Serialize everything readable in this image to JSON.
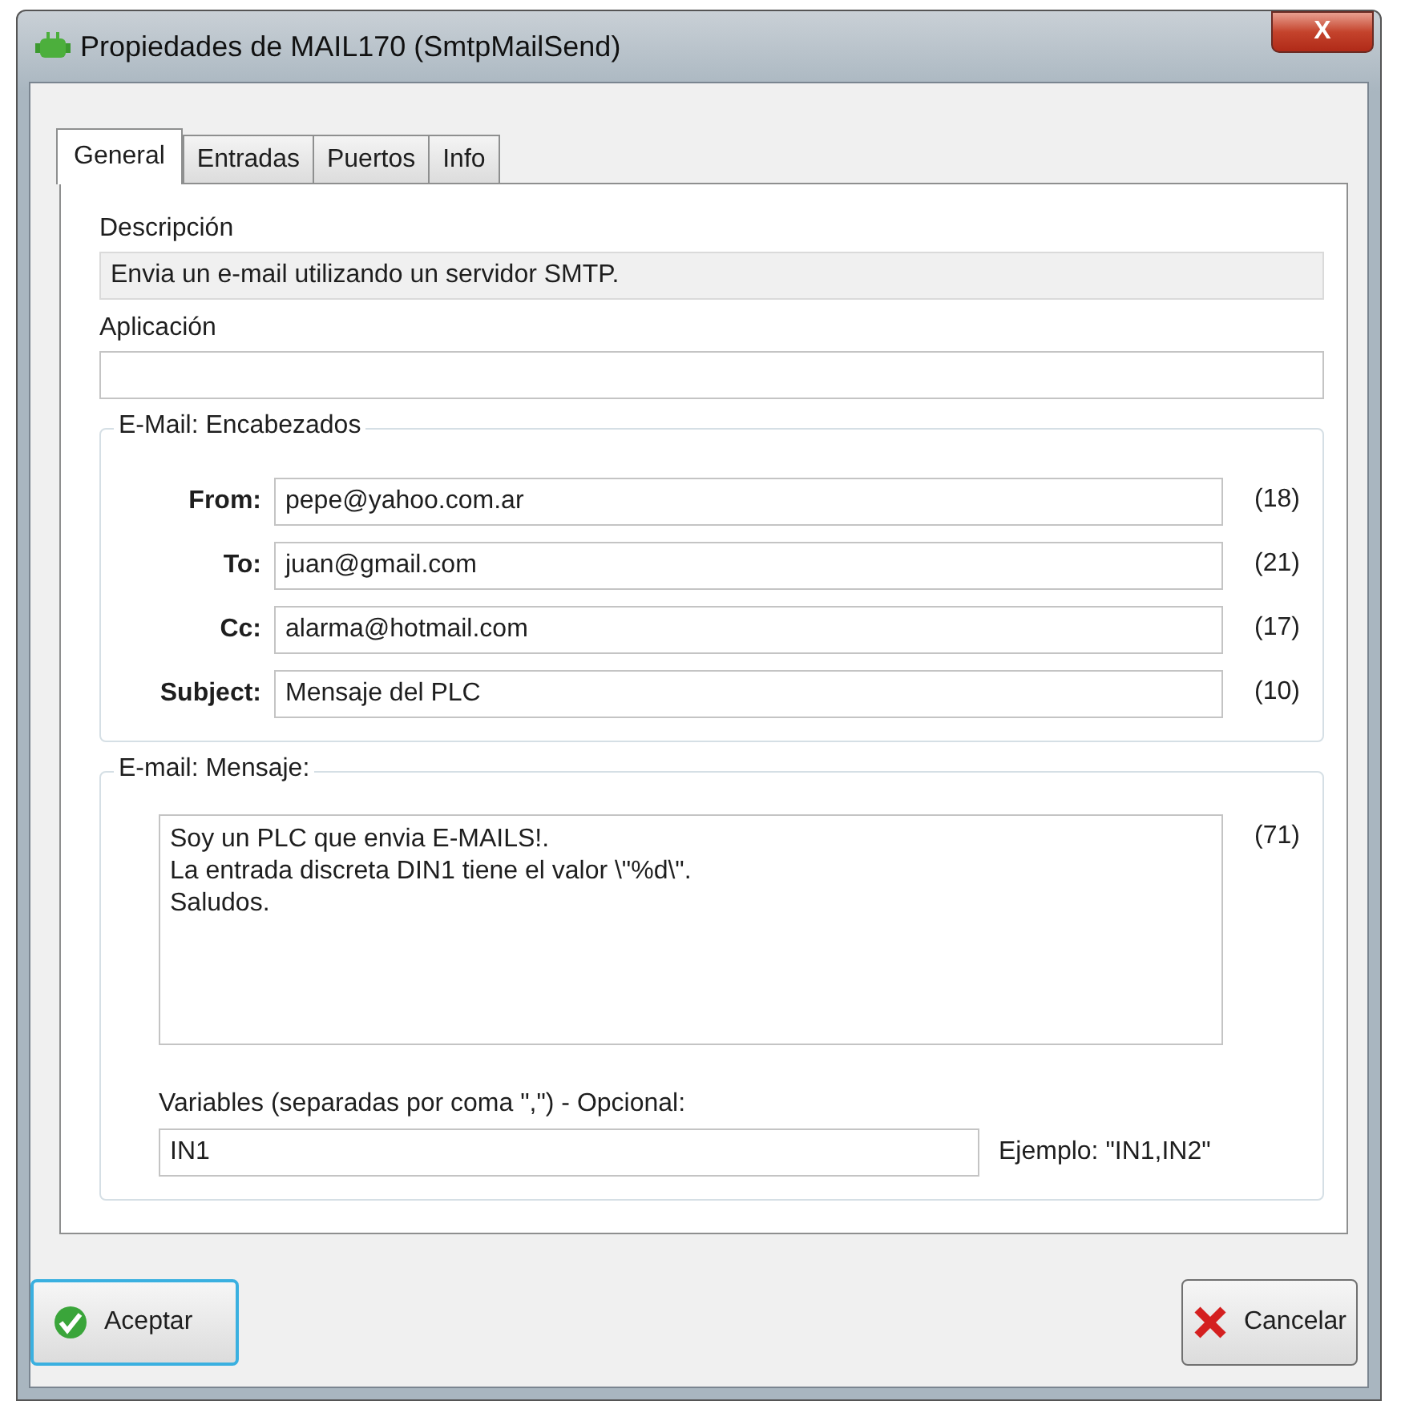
{
  "window": {
    "title": "Propiedades de MAIL170 (SmtpMailSend)",
    "close": "X"
  },
  "tabs": [
    {
      "label": "General",
      "selected": true
    },
    {
      "label": "Entradas",
      "selected": false
    },
    {
      "label": "Puertos",
      "selected": false
    },
    {
      "label": "Info",
      "selected": false
    }
  ],
  "description": {
    "label": "Descripción",
    "value": "Envia un e-mail utilizando un servidor SMTP."
  },
  "application": {
    "label": "Aplicación"
  },
  "headers": {
    "title": "E-Mail: Encabezados",
    "rows": [
      {
        "label": "From:",
        "value": "pepe@yahoo.com.ar",
        "count": "(18)"
      },
      {
        "label": "To:",
        "value": "juan@gmail.com",
        "count": "(21)"
      },
      {
        "label": "Cc:",
        "value": "alarma@hotmail.com",
        "count": "(17)"
      },
      {
        "label": "Subject:",
        "value": "Mensaje del PLC",
        "count": "(10)"
      }
    ]
  },
  "message": {
    "title": "E-mail: Mensaje:",
    "value": "Soy un PLC que envia E-MAILS!.\nLa entrada discreta DIN1 tiene el valor \\\"%d\\\".\nSaludos.",
    "count": "(71)",
    "variables_label": "Variables (separadas por coma \",\") - Opcional:",
    "variables_value": "IN1",
    "example": "Ejemplo: \"IN1,IN2\""
  },
  "buttons": [
    {
      "kind": "ok",
      "label": "Aceptar",
      "focused": true
    },
    {
      "kind": "cancel",
      "label": "Cancelar",
      "focused": false
    }
  ]
}
